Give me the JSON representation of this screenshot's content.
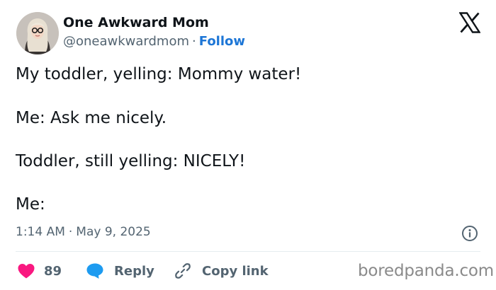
{
  "author": {
    "name": "One Awkward Mom",
    "handle": "@oneawkwardmom",
    "separator": "·",
    "follow_label": "Follow"
  },
  "tweet": {
    "lines": [
      "My toddler, yelling: Mommy water!",
      "Me: Ask me nicely.",
      "Toddler, still yelling: NICELY!",
      "Me:"
    ],
    "time": "1:14 AM",
    "separator": "·",
    "date": "May 9, 2025"
  },
  "actions": {
    "like_count": "89",
    "reply_label": "Reply",
    "copy_link_label": "Copy link"
  },
  "watermark": "boredpanda.com",
  "icons": {
    "platform_logo": "x-logo-icon",
    "info": "info-icon",
    "like": "heart-icon",
    "reply": "speech-bubble-icon",
    "copy_link": "link-icon"
  },
  "colors": {
    "text": "#0f1419",
    "secondary": "#536471",
    "follow": "#1d76d6",
    "heart": "#f91880",
    "reply_bubble": "#1d9bf0",
    "divider": "#e6ecf0",
    "watermark": "#8a8a8a"
  }
}
